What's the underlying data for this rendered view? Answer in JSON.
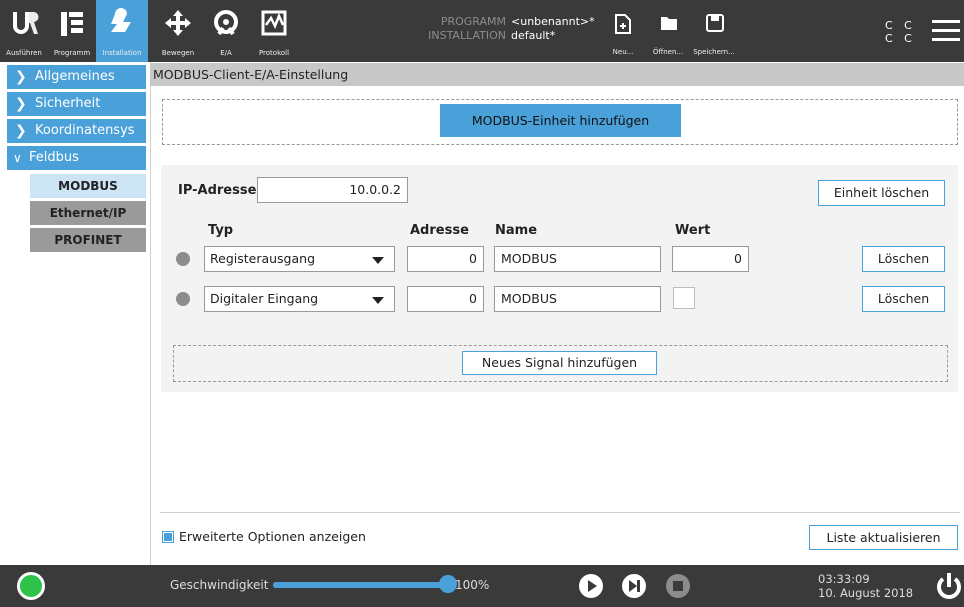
{
  "topbar": {
    "tabs": [
      {
        "label": "Ausführen",
        "icon": "ur-logo-icon"
      },
      {
        "label": "Programm",
        "icon": "program-icon"
      },
      {
        "label": "Installation",
        "icon": "installation-icon"
      },
      {
        "label": "Bewegen",
        "icon": "move-icon"
      },
      {
        "label": "E/A",
        "icon": "io-icon"
      },
      {
        "label": "Protokoll",
        "icon": "log-icon"
      }
    ],
    "program_key": "PROGRAMM",
    "program_value": "<unbenannt>*",
    "installation_key": "INSTALLATION",
    "installation_value": "default*",
    "file_buttons": [
      {
        "label": "Neu...",
        "icon": "new-file-icon"
      },
      {
        "label": "Öffnen...",
        "icon": "folder-icon"
      },
      {
        "label": "Speichern...",
        "icon": "save-icon"
      }
    ],
    "cc_line1": "C C",
    "cc_line2": "C C"
  },
  "nav": {
    "categories": [
      "Allgemeines",
      "Sicherheit",
      "Koordinatensys",
      "Feldbus"
    ],
    "subitems": [
      "MODBUS",
      "Ethernet/IP",
      "PROFINET"
    ]
  },
  "main": {
    "section_title": "MODBUS-Client-E/A-Einstellung",
    "add_unit_label": "MODBUS-Einheit hinzufügen",
    "ip_label": "IP-Adresse",
    "ip_value": "10.0.0.2",
    "delete_unit_label": "Einheit löschen",
    "col_type": "Typ",
    "col_address": "Adresse",
    "col_name": "Name",
    "col_value": "Wert",
    "signals": [
      {
        "type": "Registerausgang",
        "address": "0",
        "name": "MODBUS",
        "value": "0",
        "delete": "Löschen"
      },
      {
        "type": "Digitaler Eingang",
        "address": "0",
        "name": "MODBUS",
        "value": "",
        "delete": "Löschen"
      }
    ],
    "add_signal_label": "Neues Signal hinzufügen",
    "advanced_options_label": "Erweiterte Optionen anzeigen",
    "refresh_list_label": "Liste aktualisieren"
  },
  "bottombar": {
    "speed_label": "Geschwindigkeit",
    "speed_value": "100%",
    "speed_fraction": 1.0,
    "time": "03:33:09",
    "date": "10. August 2018"
  },
  "colors": {
    "accent": "#4aa0d8",
    "topbar_bg": "#3a3a3a",
    "status_green": "#2ec24a"
  }
}
